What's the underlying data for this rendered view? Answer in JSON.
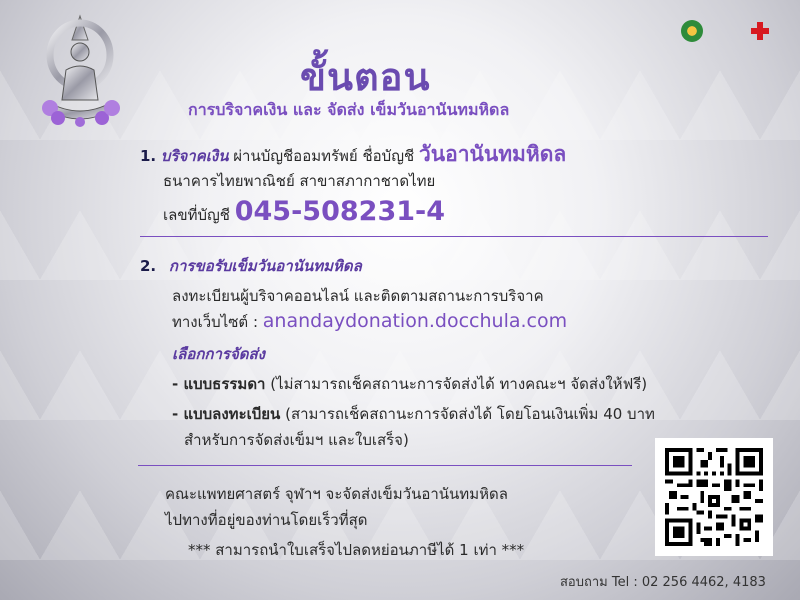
{
  "header": {
    "title": "ขั้นตอน",
    "subtitle": "การบริจาคเงิน และ จัดส่ง เข็มวันอานันทมหิดล"
  },
  "step1": {
    "number": "1.",
    "heading": "บริจาคเงิน",
    "text_account_prefix": "ผ่านบัญชีออมทรัพย์ ชื่อบัญชี",
    "account_name": "วันอานันทมหิดล",
    "bank_line": "ธนาคารไทยพาณิชย์ สาขาสภากาชาดไทย",
    "account_no_label": "เลขที่บัญชี",
    "account_no": "045-508231-4"
  },
  "step2": {
    "number": "2.",
    "heading": "การขอรับเข็มวันอานันทมหิดล",
    "line1": "ลงทะเบียนผู้บริจาคออนไลน์ และติดตามสถานะการบริจาค",
    "website_label": "ทางเว็บไซต์ :",
    "website": "anandaydonation.docchula.com",
    "shipping_heading": "เลือกการจัดส่ง",
    "option1_label": "- แบบธรรมดา",
    "option1_desc": "(ไม่สามารถเช็คสถานะการจัดส่งได้ ทางคณะฯ จัดส่งให้ฟรี)",
    "option2_label": "- แบบลงทะเบียน",
    "option2_desc": "(สามารถเช็คสถานะการจัดส่งได้ โดยโอนเงินเพิ่ม 40 บาท",
    "option2_desc2": "สำหรับการจัดส่งเข็มฯ และใบเสร็จ)"
  },
  "footer": {
    "line1": "คณะแพทยศาสตร์ จุฬาฯ จะจัดส่งเข็มวันอานันทมหิดล",
    "line2": "ไปทางที่อยู่ของท่านโดยเร็วที่สุด",
    "note": "*** สามารถนำใบเสร็จไปลดหย่อนภาษีได้ 1 เท่า ***",
    "contact": "สอบถาม Tel : 02 256 4462, 4183"
  },
  "colors": {
    "accent": "#7a4fc0",
    "accent_dark": "#5a3aa0",
    "redcross": "#d71920"
  },
  "icons": [
    "ananda-emblem-icon",
    "faculty-seal-icon",
    "red-cross-icon",
    "qr-code-icon"
  ]
}
